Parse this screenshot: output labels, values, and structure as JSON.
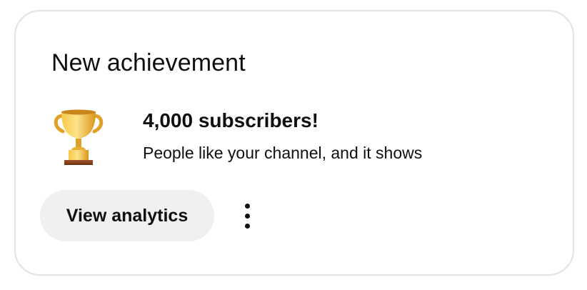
{
  "card": {
    "title": "New achievement",
    "icon": "trophy-icon",
    "headline": "4,000 subscribers!",
    "subtext": "People like your channel, and it shows",
    "primary_button_label": "View analytics",
    "more_icon": "more-vert-icon"
  },
  "colors": {
    "text": "#0f0f0f",
    "button_bg": "#f0f0f0",
    "border": "#e3e3e3",
    "trophy_gold": "#e8a317",
    "trophy_base": "#8b4513"
  }
}
